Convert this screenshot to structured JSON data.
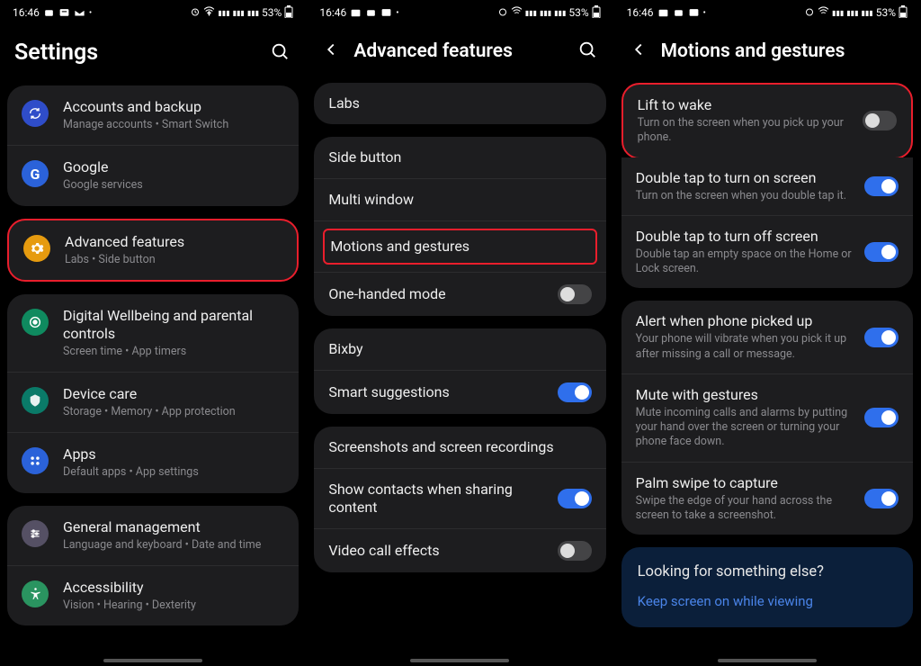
{
  "status": {
    "time": "16:46",
    "battery": "53%"
  },
  "pane1": {
    "title": "Settings",
    "items": {
      "accounts": {
        "title": "Accounts and backup",
        "sub": "Manage accounts  •  Smart Switch"
      },
      "google": {
        "title": "Google",
        "sub": "Google services"
      },
      "advanced": {
        "title": "Advanced features",
        "sub": "Labs  •  Side button"
      },
      "wellbeing": {
        "title": "Digital Wellbeing and parental controls",
        "sub": "Screen time  •  App timers"
      },
      "devicecare": {
        "title": "Device care",
        "sub": "Storage  •  Memory  •  App protection"
      },
      "apps": {
        "title": "Apps",
        "sub": "Default apps  •  App settings"
      },
      "general": {
        "title": "General management",
        "sub": "Language and keyboard  •  Date and time"
      },
      "accessibility": {
        "title": "Accessibility",
        "sub": "Vision  •  Hearing  •  Dexterity"
      }
    }
  },
  "pane2": {
    "title": "Advanced features",
    "labs": "Labs",
    "sidebutton": "Side button",
    "multiwindow": "Multi window",
    "motions": "Motions and gestures",
    "onehanded": "One-handed mode",
    "bixby": "Bixby",
    "smartsuggestions": "Smart suggestions",
    "screenshots": "Screenshots and screen recordings",
    "showcontacts": "Show contacts when sharing content",
    "videocall": "Video call effects"
  },
  "pane3": {
    "title": "Motions and gestures",
    "lift": {
      "title": "Lift to wake",
      "sub": "Turn on the screen when you pick up your phone."
    },
    "dton": {
      "title": "Double tap to turn on screen",
      "sub": "Turn on the screen when you double tap it."
    },
    "dtoff": {
      "title": "Double tap to turn off screen",
      "sub": "Double tap an empty space on the Home or Lock screen."
    },
    "alert": {
      "title": "Alert when phone picked up",
      "sub": "Your phone will vibrate when you pick it up after missing a call or message."
    },
    "mute": {
      "title": "Mute with gestures",
      "sub": "Mute incoming calls and alarms by putting your hand over the screen or turning your phone face down."
    },
    "palm": {
      "title": "Palm swipe to capture",
      "sub": "Swipe the edge of your hand across the screen to take a screenshot."
    },
    "info": {
      "q": "Looking for something else?",
      "link": "Keep screen on while viewing"
    }
  }
}
